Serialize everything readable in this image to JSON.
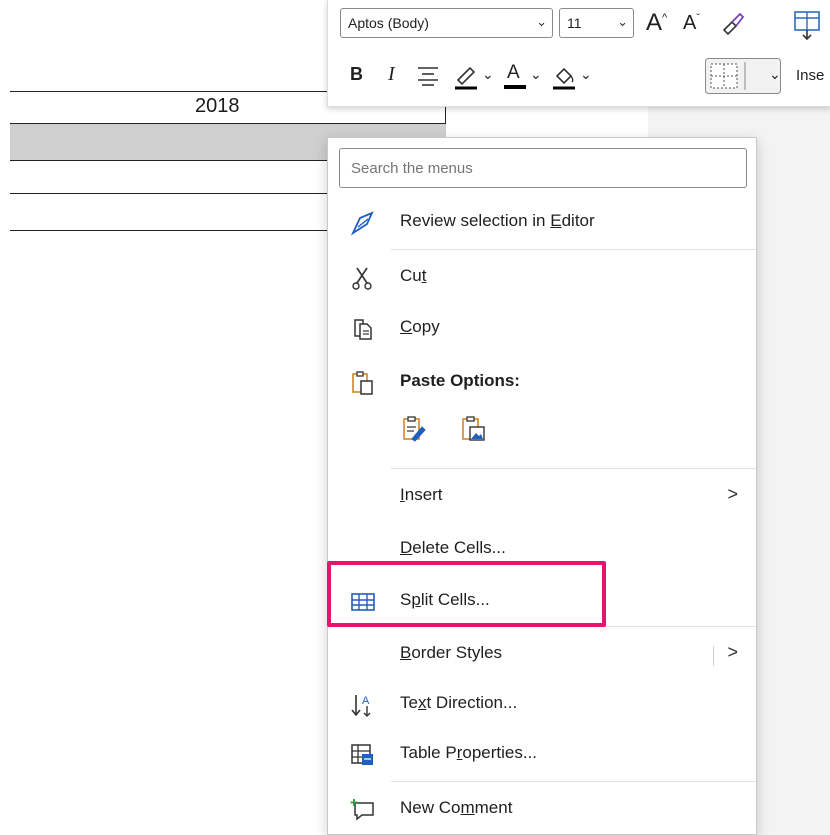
{
  "document": {
    "year": "2018"
  },
  "mini_toolbar": {
    "font_name": "Aptos (Body)",
    "font_size": "11",
    "insert_label": "Inse",
    "font_color": "#000000",
    "highlight_color": "#000000"
  },
  "context_menu": {
    "search_placeholder": "Search the menus",
    "items": [
      {
        "label": "Review selection in Editor",
        "access_key": "E",
        "icon": "editor-pen-icon"
      },
      {
        "label": "Cut",
        "access_key": "t",
        "icon": "scissors-icon"
      },
      {
        "label": "Copy",
        "access_key": "C",
        "icon": "copy-icon"
      },
      {
        "label": "Paste Options:",
        "icon": "clipboard-icon"
      },
      {
        "label": "Insert",
        "access_key": "I",
        "submenu": true
      },
      {
        "label": "Delete Cells...",
        "access_key": "D"
      },
      {
        "label": "Split Cells...",
        "access_key": "p",
        "icon": "split-cells-icon",
        "highlighted": true
      },
      {
        "label": "Border Styles",
        "access_key": "B",
        "submenu": true
      },
      {
        "label": "Text Direction...",
        "access_key": "x",
        "icon": "text-direction-icon"
      },
      {
        "label": "Table Properties...",
        "access_key": "r",
        "icon": "table-properties-icon"
      },
      {
        "label": "New Comment",
        "access_key": "m",
        "icon": "new-comment-icon"
      }
    ]
  },
  "colors": {
    "highlight_box": "#e2166b",
    "accent_blue": "#1f5fbf",
    "paste_orange": "#d4862a"
  }
}
